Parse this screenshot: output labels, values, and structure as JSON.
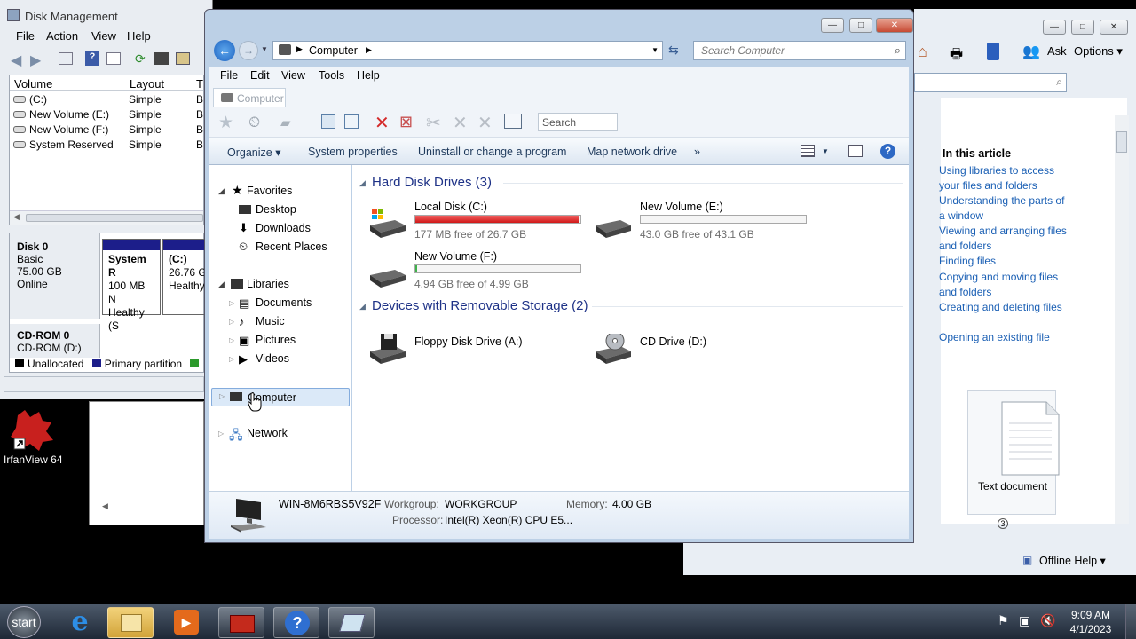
{
  "disk_mgmt": {
    "title": "Disk Management",
    "menu": [
      "File",
      "Action",
      "View",
      "Help"
    ],
    "columns": [
      "Volume",
      "Layout",
      "T"
    ],
    "volumes": [
      {
        "name": "(C:)",
        "layout": "Simple",
        "t": "B"
      },
      {
        "name": "New Volume (E:)",
        "layout": "Simple",
        "t": "B"
      },
      {
        "name": "New Volume (F:)",
        "layout": "Simple",
        "t": "B"
      },
      {
        "name": "System Reserved",
        "layout": "Simple",
        "t": "B"
      }
    ],
    "disk0": {
      "label": "Disk 0",
      "type": "Basic",
      "size": "75.00 GB",
      "status": "Online"
    },
    "partition_sys": {
      "name": "System R",
      "size": "100 MB N",
      "status": "Healthy (S"
    },
    "partition_c": {
      "name": "(C:)",
      "size": "26.76 G",
      "status": "Healthy"
    },
    "cdrom": {
      "label": "CD-ROM 0",
      "device": "CD-ROM (D:)"
    },
    "legend": [
      "Unallocated",
      "Primary partition",
      "E"
    ]
  },
  "desktop": {
    "irfan_label": "IrfanView 64"
  },
  "explorer": {
    "breadcrumb": "Computer",
    "search_placeholder": "Search Computer",
    "menu": [
      "File",
      "Edit",
      "View",
      "Tools",
      "Help"
    ],
    "tab_label": "Computer",
    "toolbar_search": "Search",
    "commands": [
      "Organize ▾",
      "System properties",
      "Uninstall or change a program",
      "Map network drive",
      "»"
    ],
    "nav": {
      "favorites": "Favorites",
      "desktop": "Desktop",
      "downloads": "Downloads",
      "recent": "Recent Places",
      "libraries": "Libraries",
      "documents": "Documents",
      "music": "Music",
      "pictures": "Pictures",
      "videos": "Videos",
      "computer": "Computer",
      "network": "Network"
    },
    "hdd_group": "Hard Disk Drives (3)",
    "removable_group": "Devices with Removable Storage (2)",
    "drives": [
      {
        "name": "Local Disk (C:)",
        "free": "177 MB free of 26.7 GB",
        "used_fraction": 0.99
      },
      {
        "name": "New Volume (E:)",
        "free": "43.0 GB free of 43.1 GB",
        "used_fraction": 0.0
      },
      {
        "name": "New Volume (F:)",
        "free": "4.94 GB free of 4.99 GB",
        "used_fraction": 0.01
      }
    ],
    "removable": [
      {
        "name": "Floppy Disk Drive (A:)"
      },
      {
        "name": "CD Drive (D:)"
      }
    ],
    "details": {
      "computer_name": "WIN-8M6RBS5V92F",
      "workgroup_label": "Workgroup:",
      "workgroup": "WORKGROUP",
      "memory_label": "Memory:",
      "memory": "4.00 GB",
      "processor_label": "Processor:",
      "processor": "Intel(R) Xeon(R) CPU E5..."
    }
  },
  "help": {
    "ask": "Ask",
    "options": "Options ▾",
    "in_this_article": "In this article",
    "links": [
      "Using libraries to access your files and folders",
      "Understanding the parts of a window",
      "Viewing and arranging files and folders",
      "Finding files",
      "Copying and moving files and folders",
      "Creating and deleting files",
      "Opening an existing file"
    ],
    "text_document": "Text document",
    "badge": "3",
    "offline_help": "Offline Help ▾"
  },
  "taskbar": {
    "start": "start",
    "time": "9:09 AM",
    "date": "4/1/2023"
  }
}
